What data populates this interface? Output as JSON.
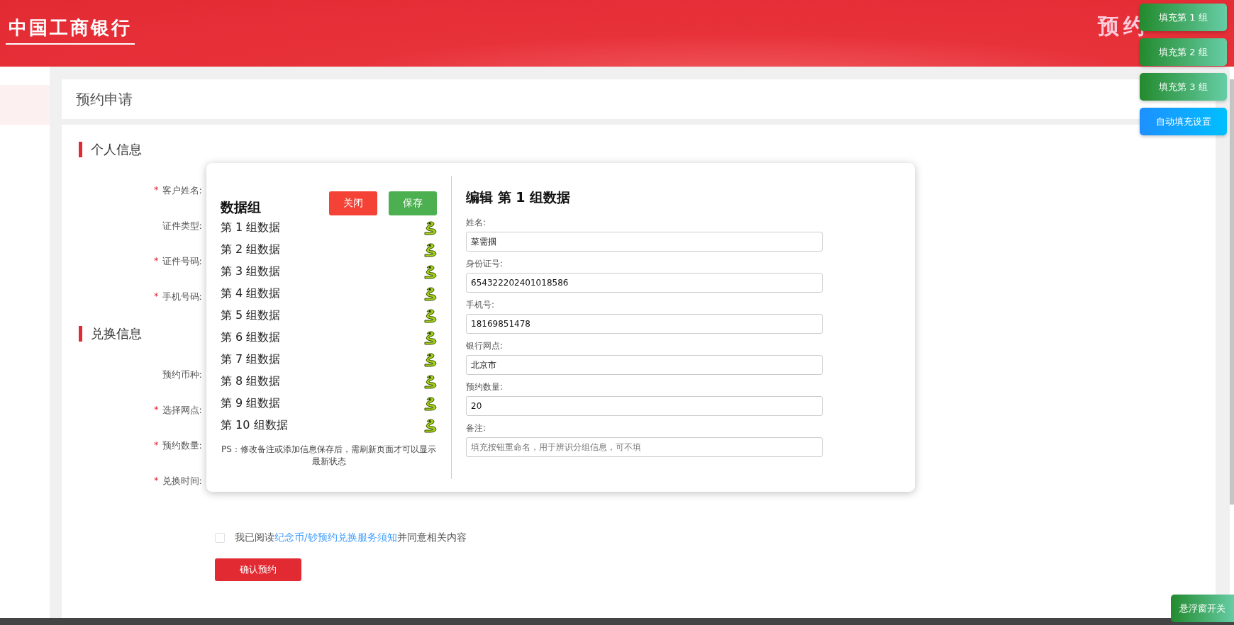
{
  "header": {
    "logo": "中国工商银行",
    "banner_text": "预约"
  },
  "page": {
    "title": "预约申请"
  },
  "sections": [
    {
      "title": "个人信息",
      "fields": [
        {
          "label": "客户姓名:",
          "marker": "*"
        },
        {
          "label": "证件类型:"
        },
        {
          "label": "证件号码:",
          "marker": "*"
        },
        {
          "label": "手机号码:",
          "marker": "*"
        }
      ]
    },
    {
      "title": "兑换信息",
      "fields": [
        {
          "label": "预约币种:"
        },
        {
          "label": "选择网点:",
          "marker": "*"
        },
        {
          "label": "预约数量:",
          "marker": "*"
        },
        {
          "label": "兑换时间:",
          "marker": "*"
        }
      ]
    }
  ],
  "agreement": {
    "checked": false,
    "before": "我已阅读",
    "link": "纪念币/钞预约兑换服务须知",
    "after": "并同意相关内容"
  },
  "submit": "确认预约",
  "modal": {
    "title": "数据组",
    "close": "关闭",
    "save": "保存",
    "groups": [
      {
        "label": "第 1 组数据"
      },
      {
        "label": "第 2 组数据"
      },
      {
        "label": "第 3 组数据"
      },
      {
        "label": "第 4 组数据"
      },
      {
        "label": "第 5 组数据"
      },
      {
        "label": "第 6 组数据"
      },
      {
        "label": "第 7 组数据"
      },
      {
        "label": "第 8 组数据"
      },
      {
        "label": "第 9 组数据"
      },
      {
        "label": "第 10 组数据"
      }
    ],
    "note": "PS：修改备注或添加信息保存后，需刷新页面才可以显示最新状态",
    "edit_title": "编辑 第 1 组数据",
    "fields": [
      {
        "label": "姓名:",
        "value": "菜需掴"
      },
      {
        "label": "身份证号:",
        "value": "654322202401018586"
      },
      {
        "label": "手机号:",
        "value": "18169851478"
      },
      {
        "label": "银行网点:",
        "value": "北京市"
      },
      {
        "label": "预约数量:",
        "value": "20"
      },
      {
        "label": "备注:",
        "placeholder": "填充按钮重命名，用于辨识分组信息，可不填"
      }
    ]
  },
  "float_buttons": [
    {
      "label": "填充第 1 组",
      "kind": "fill"
    },
    {
      "label": "填充第 2 组",
      "kind": "fill"
    },
    {
      "label": "填充第 3 组",
      "kind": "fill"
    },
    {
      "label": "自动填充设置",
      "kind": "settings"
    }
  ],
  "toggle_button": "悬浮窗开关"
}
